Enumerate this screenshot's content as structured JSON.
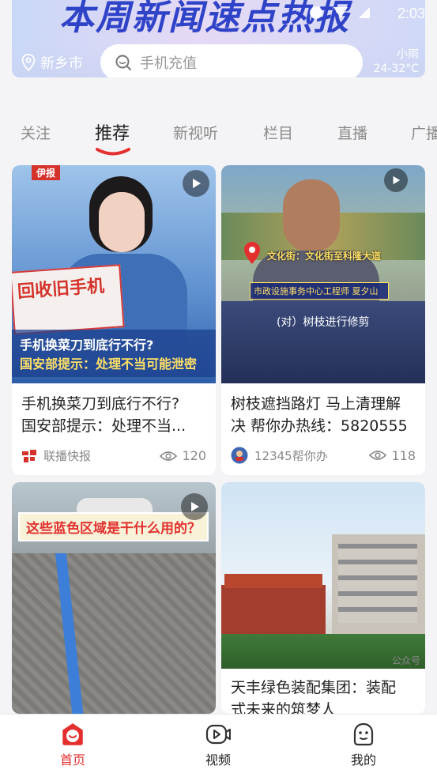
{
  "status_bar": {
    "time": "2:03"
  },
  "header": {
    "banner_text": "本周新闻速点热报",
    "location": "新乡市",
    "search_placeholder": "手机充值",
    "weather": {
      "condition": "小雨",
      "temp": "24-32°C"
    }
  },
  "tabs": [
    {
      "label": "关注"
    },
    {
      "label": "推荐"
    },
    {
      "label": "新视听"
    },
    {
      "label": "栏目"
    },
    {
      "label": "直播"
    },
    {
      "label": "广播"
    }
  ],
  "cards": [
    {
      "badge": "伊报",
      "overlay_sign": "回收旧手机",
      "overlay_line1": "手机换菜刀到底行不行?",
      "overlay_line2": "国安部提示：处理不当可能泄密",
      "title_line1": "手机换菜刀到底行不行?",
      "title_line2": "国安部提示：处理不当...",
      "source": "联播快报",
      "views": "120",
      "icon": "play-icon"
    },
    {
      "overlay_loc": "文化街：文化街至科隆大道",
      "overlay_org": "市政设施事务中心工程师 夏夕山",
      "overlay_caption": "(对）树枝进行修剪",
      "title_line1": "树枝遮挡路灯 马上清理解",
      "title_line2": "决 帮你办热线：5820555",
      "source": "12345帮你办",
      "views": "118",
      "icon": "play-icon"
    },
    {
      "overlay_banner": "这些蓝色区域是干什么用的？",
      "icon": "play-icon"
    },
    {
      "watermark": "公众号",
      "title_line1": "天丰绿色装配集团：装配",
      "title_line2": "式未来的筑梦人"
    }
  ],
  "bottom_nav": [
    {
      "label": "首页",
      "icon": "home-icon",
      "active": true
    },
    {
      "label": "视频",
      "icon": "video-icon",
      "active": false
    },
    {
      "label": "我的",
      "icon": "profile-icon",
      "active": false
    }
  ],
  "colors": {
    "accent": "#e3302f",
    "banner_blue": "#2f43c8"
  }
}
